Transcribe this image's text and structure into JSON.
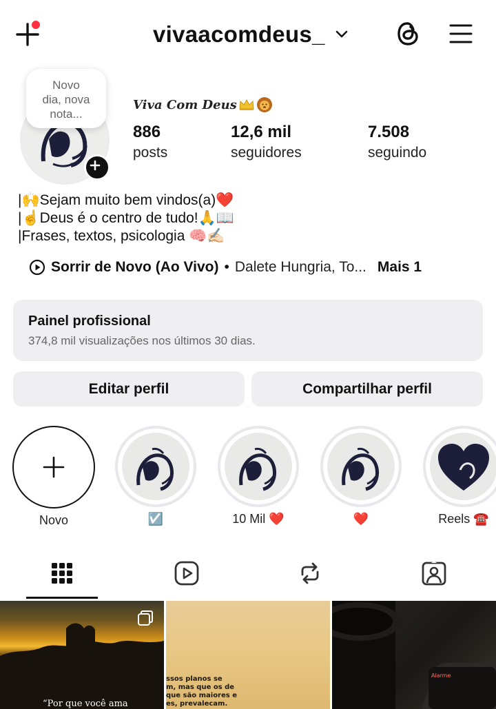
{
  "header": {
    "username": "vivaacomdeus_",
    "accent_dot_color": "#ff3040"
  },
  "note": {
    "lines": [
      "Novo",
      "dia, nova",
      "nota..."
    ]
  },
  "profile": {
    "display_name": "Viva Com Deus",
    "display_name_emojis": [
      "crown",
      "lion"
    ],
    "stats": [
      {
        "value": "886",
        "label": "posts"
      },
      {
        "value": "12,6 mil",
        "label": "seguidores"
      },
      {
        "value": "7.508",
        "label": "seguindo"
      }
    ],
    "bio": [
      "|🙌Sejam muito bem vindos(a)❤️",
      "|☝️Deus é o centro de tudo!🙏📖",
      "|Frases, textos, psicologia 🧠✍🏻"
    ],
    "music": {
      "song": "Sorrir de Novo (Ao Vivo)",
      "separator": "•",
      "artist": "Dalete Hungria, To...",
      "more": "Mais 1"
    }
  },
  "dashboard": {
    "title": "Painel profissional",
    "subtitle": "374,8 mil visualizações nos últimos 30 dias."
  },
  "actions": {
    "edit": "Editar perfil",
    "share": "Compartilhar perfil"
  },
  "highlights": [
    {
      "label": "Novo",
      "kind": "new"
    },
    {
      "label": "☑️",
      "kind": "lion"
    },
    {
      "label": "10 Mil ❤️",
      "kind": "lion"
    },
    {
      "label": "❤️",
      "kind": "lion"
    },
    {
      "label": "Reels ☎️",
      "kind": "heart-lion"
    }
  ],
  "tabs": [
    {
      "name": "grid-icon",
      "active": true
    },
    {
      "name": "reels-icon",
      "active": false
    },
    {
      "name": "reposts-icon",
      "active": false
    },
    {
      "name": "tagged-icon",
      "active": false
    }
  ],
  "posts": {
    "post1_text": "“Por que você ama",
    "post2_lines": [
      "ssos planos se",
      "m, mas que os de",
      "que são maiores e",
      "es, prevalecam."
    ],
    "post3_label": "Alarme"
  }
}
